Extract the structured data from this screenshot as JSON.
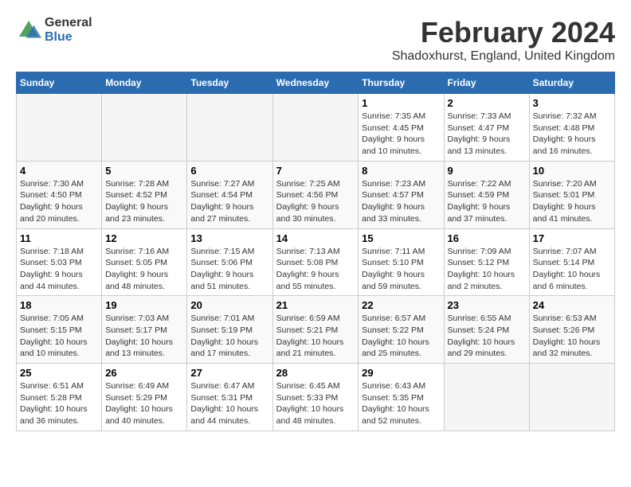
{
  "logo": {
    "general": "General",
    "blue": "Blue"
  },
  "title": "February 2024",
  "subtitle": "Shadoxhurst, England, United Kingdom",
  "days_of_week": [
    "Sunday",
    "Monday",
    "Tuesday",
    "Wednesday",
    "Thursday",
    "Friday",
    "Saturday"
  ],
  "weeks": [
    [
      {
        "day": "",
        "info": ""
      },
      {
        "day": "",
        "info": ""
      },
      {
        "day": "",
        "info": ""
      },
      {
        "day": "",
        "info": ""
      },
      {
        "day": "1",
        "info": "Sunrise: 7:35 AM\nSunset: 4:45 PM\nDaylight: 9 hours\nand 10 minutes."
      },
      {
        "day": "2",
        "info": "Sunrise: 7:33 AM\nSunset: 4:47 PM\nDaylight: 9 hours\nand 13 minutes."
      },
      {
        "day": "3",
        "info": "Sunrise: 7:32 AM\nSunset: 4:48 PM\nDaylight: 9 hours\nand 16 minutes."
      }
    ],
    [
      {
        "day": "4",
        "info": "Sunrise: 7:30 AM\nSunset: 4:50 PM\nDaylight: 9 hours\nand 20 minutes."
      },
      {
        "day": "5",
        "info": "Sunrise: 7:28 AM\nSunset: 4:52 PM\nDaylight: 9 hours\nand 23 minutes."
      },
      {
        "day": "6",
        "info": "Sunrise: 7:27 AM\nSunset: 4:54 PM\nDaylight: 9 hours\nand 27 minutes."
      },
      {
        "day": "7",
        "info": "Sunrise: 7:25 AM\nSunset: 4:56 PM\nDaylight: 9 hours\nand 30 minutes."
      },
      {
        "day": "8",
        "info": "Sunrise: 7:23 AM\nSunset: 4:57 PM\nDaylight: 9 hours\nand 33 minutes."
      },
      {
        "day": "9",
        "info": "Sunrise: 7:22 AM\nSunset: 4:59 PM\nDaylight: 9 hours\nand 37 minutes."
      },
      {
        "day": "10",
        "info": "Sunrise: 7:20 AM\nSunset: 5:01 PM\nDaylight: 9 hours\nand 41 minutes."
      }
    ],
    [
      {
        "day": "11",
        "info": "Sunrise: 7:18 AM\nSunset: 5:03 PM\nDaylight: 9 hours\nand 44 minutes."
      },
      {
        "day": "12",
        "info": "Sunrise: 7:16 AM\nSunset: 5:05 PM\nDaylight: 9 hours\nand 48 minutes."
      },
      {
        "day": "13",
        "info": "Sunrise: 7:15 AM\nSunset: 5:06 PM\nDaylight: 9 hours\nand 51 minutes."
      },
      {
        "day": "14",
        "info": "Sunrise: 7:13 AM\nSunset: 5:08 PM\nDaylight: 9 hours\nand 55 minutes."
      },
      {
        "day": "15",
        "info": "Sunrise: 7:11 AM\nSunset: 5:10 PM\nDaylight: 9 hours\nand 59 minutes."
      },
      {
        "day": "16",
        "info": "Sunrise: 7:09 AM\nSunset: 5:12 PM\nDaylight: 10 hours\nand 2 minutes."
      },
      {
        "day": "17",
        "info": "Sunrise: 7:07 AM\nSunset: 5:14 PM\nDaylight: 10 hours\nand 6 minutes."
      }
    ],
    [
      {
        "day": "18",
        "info": "Sunrise: 7:05 AM\nSunset: 5:15 PM\nDaylight: 10 hours\nand 10 minutes."
      },
      {
        "day": "19",
        "info": "Sunrise: 7:03 AM\nSunset: 5:17 PM\nDaylight: 10 hours\nand 13 minutes."
      },
      {
        "day": "20",
        "info": "Sunrise: 7:01 AM\nSunset: 5:19 PM\nDaylight: 10 hours\nand 17 minutes."
      },
      {
        "day": "21",
        "info": "Sunrise: 6:59 AM\nSunset: 5:21 PM\nDaylight: 10 hours\nand 21 minutes."
      },
      {
        "day": "22",
        "info": "Sunrise: 6:57 AM\nSunset: 5:22 PM\nDaylight: 10 hours\nand 25 minutes."
      },
      {
        "day": "23",
        "info": "Sunrise: 6:55 AM\nSunset: 5:24 PM\nDaylight: 10 hours\nand 29 minutes."
      },
      {
        "day": "24",
        "info": "Sunrise: 6:53 AM\nSunset: 5:26 PM\nDaylight: 10 hours\nand 32 minutes."
      }
    ],
    [
      {
        "day": "25",
        "info": "Sunrise: 6:51 AM\nSunset: 5:28 PM\nDaylight: 10 hours\nand 36 minutes."
      },
      {
        "day": "26",
        "info": "Sunrise: 6:49 AM\nSunset: 5:29 PM\nDaylight: 10 hours\nand 40 minutes."
      },
      {
        "day": "27",
        "info": "Sunrise: 6:47 AM\nSunset: 5:31 PM\nDaylight: 10 hours\nand 44 minutes."
      },
      {
        "day": "28",
        "info": "Sunrise: 6:45 AM\nSunset: 5:33 PM\nDaylight: 10 hours\nand 48 minutes."
      },
      {
        "day": "29",
        "info": "Sunrise: 6:43 AM\nSunset: 5:35 PM\nDaylight: 10 hours\nand 52 minutes."
      },
      {
        "day": "",
        "info": ""
      },
      {
        "day": "",
        "info": ""
      }
    ]
  ]
}
